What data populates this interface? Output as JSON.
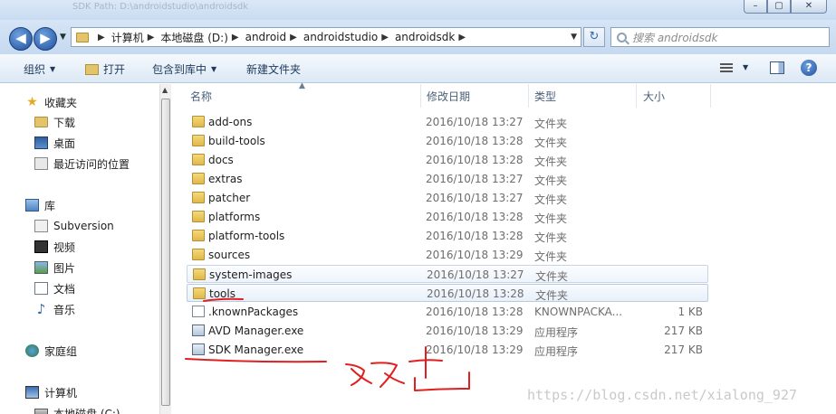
{
  "window": {
    "title_ghost": "SDK Path: D:\\androidstudio\\androidsdk",
    "controls": [
      "–",
      "▢",
      "✕"
    ]
  },
  "address": {
    "crumbs": [
      "计算机",
      "本地磁盘 (D:)",
      "android",
      "androidstudio",
      "androidsdk"
    ],
    "search_placeholder": "搜索 androidsdk"
  },
  "toolbar": {
    "organize": "组织",
    "open": "打开",
    "include_in_library": "包含到库中",
    "new_folder": "新建文件夹"
  },
  "navpane": {
    "items": [
      {
        "label": "收藏夹",
        "icon": "star-icon"
      },
      {
        "label": "下载",
        "icon": "download-folder-icon"
      },
      {
        "label": "桌面",
        "icon": "desktop-icon"
      },
      {
        "label": "最近访问的位置",
        "icon": "recent-places-icon"
      },
      {
        "label": "库",
        "icon": "library-icon"
      },
      {
        "label": "Subversion",
        "icon": "subversion-icon"
      },
      {
        "label": "视频",
        "icon": "video-icon"
      },
      {
        "label": "图片",
        "icon": "pictures-icon"
      },
      {
        "label": "文档",
        "icon": "documents-icon"
      },
      {
        "label": "音乐",
        "icon": "music-icon"
      },
      {
        "label": "家庭组",
        "icon": "homegroup-icon"
      },
      {
        "label": "计算机",
        "icon": "computer-icon"
      },
      {
        "label": "本地磁盘 (C:)",
        "icon": "drive-icon"
      }
    ]
  },
  "columns": {
    "name": "名称",
    "date": "修改日期",
    "type": "类型",
    "size": "大小"
  },
  "files": [
    {
      "name": "add-ons",
      "date": "2016/10/18 13:27",
      "type": "文件夹",
      "size": "",
      "kind": "folder"
    },
    {
      "name": "build-tools",
      "date": "2016/10/18 13:28",
      "type": "文件夹",
      "size": "",
      "kind": "folder"
    },
    {
      "name": "docs",
      "date": "2016/10/18 13:28",
      "type": "文件夹",
      "size": "",
      "kind": "folder"
    },
    {
      "name": "extras",
      "date": "2016/10/18 13:27",
      "type": "文件夹",
      "size": "",
      "kind": "folder"
    },
    {
      "name": "patcher",
      "date": "2016/10/18 13:27",
      "type": "文件夹",
      "size": "",
      "kind": "folder"
    },
    {
      "name": "platforms",
      "date": "2016/10/18 13:28",
      "type": "文件夹",
      "size": "",
      "kind": "folder"
    },
    {
      "name": "platform-tools",
      "date": "2016/10/18 13:28",
      "type": "文件夹",
      "size": "",
      "kind": "folder"
    },
    {
      "name": "sources",
      "date": "2016/10/18 13:29",
      "type": "文件夹",
      "size": "",
      "kind": "folder"
    },
    {
      "name": "system-images",
      "date": "2016/10/18 13:27",
      "type": "文件夹",
      "size": "",
      "kind": "folder"
    },
    {
      "name": "tools",
      "date": "2016/10/18 13:28",
      "type": "文件夹",
      "size": "",
      "kind": "folder"
    },
    {
      "name": ".knownPackages",
      "date": "2016/10/18 13:28",
      "type": "KNOWNPACKA...",
      "size": "1 KB",
      "kind": "file"
    },
    {
      "name": "AVD Manager.exe",
      "date": "2016/10/18 13:29",
      "type": "应用程序",
      "size": "217 KB",
      "kind": "exe"
    },
    {
      "name": "SDK Manager.exe",
      "date": "2016/10/18 13:29",
      "type": "应用程序",
      "size": "217 KB",
      "kind": "exe"
    }
  ],
  "annotation_color": "#e02020",
  "watermark": "https://blog.csdn.net/xialong_927"
}
